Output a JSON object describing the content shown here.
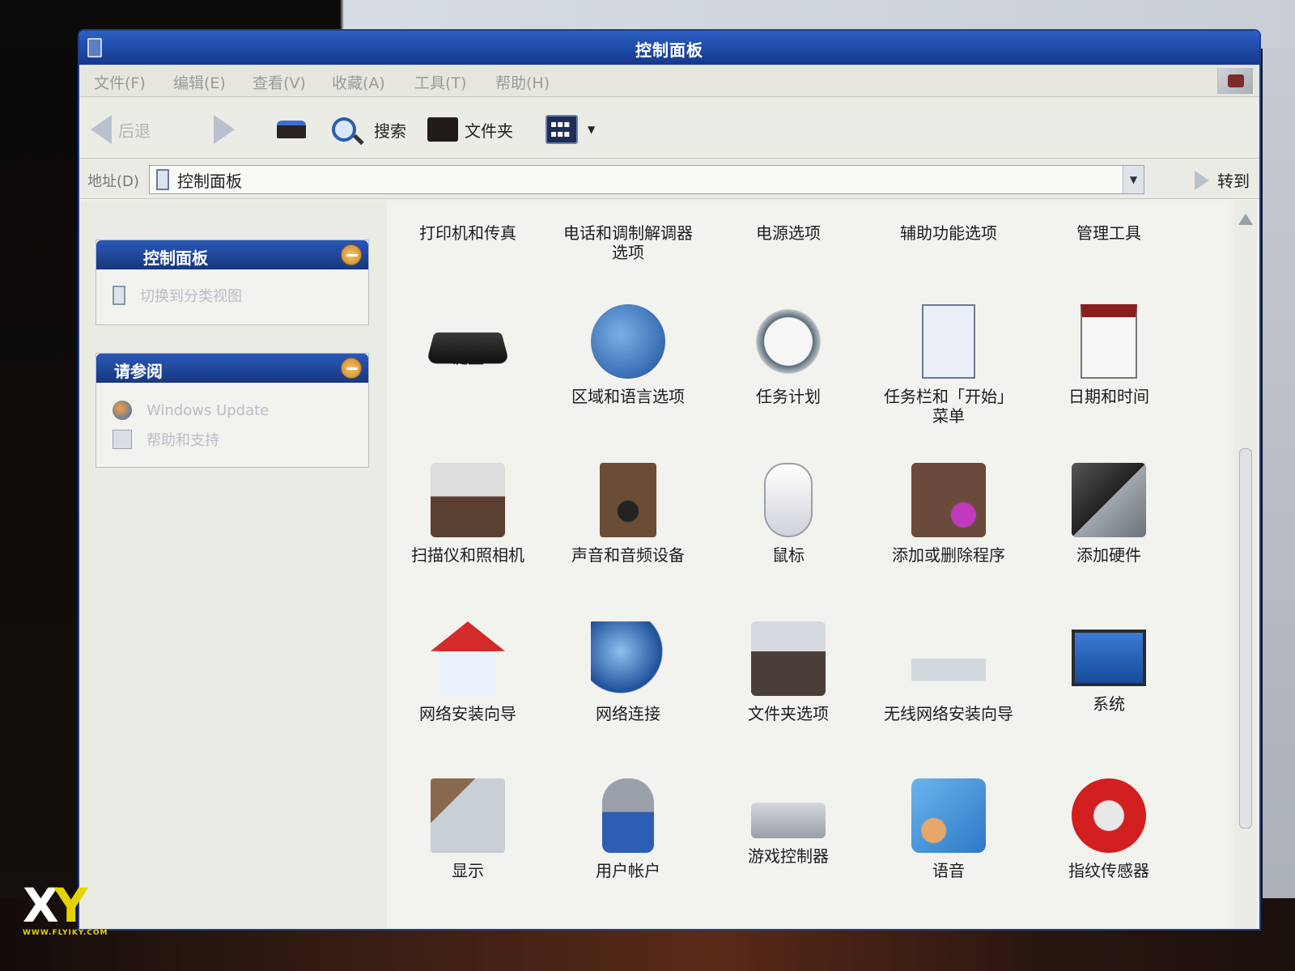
{
  "window": {
    "title": "控制面板"
  },
  "menu": [
    {
      "label": "文件(F)"
    },
    {
      "label": "编辑(E)"
    },
    {
      "label": "查看(V)"
    },
    {
      "label": "收藏(A)"
    },
    {
      "label": "工具(T)"
    },
    {
      "label": "帮助(H)"
    }
  ],
  "toolbar": {
    "back_label": "后退",
    "search_label": "搜索",
    "folders_label": "文件夹"
  },
  "address": {
    "label": "地址(D)",
    "value": "控制面板",
    "go_label": "转到"
  },
  "sidebar": {
    "panel1": {
      "title": "控制面板",
      "links": [
        {
          "label": "切换到分类视图"
        }
      ]
    },
    "panel2": {
      "title": "请参阅",
      "links": [
        {
          "label": "Windows Update"
        },
        {
          "label": "帮助和支持"
        }
      ]
    }
  },
  "items": [
    {
      "label": "打印机和传真",
      "icon": "printer-icon"
    },
    {
      "label": "电话和调制解调器\n选项",
      "icon": "phone-modem-icon"
    },
    {
      "label": "电源选项",
      "icon": "power-icon"
    },
    {
      "label": "辅助功能选项",
      "icon": "accessibility-icon"
    },
    {
      "label": "管理工具",
      "icon": "admin-tools-icon"
    },
    {
      "label": "键盘",
      "icon": "keyboard-icon"
    },
    {
      "label": "区域和语言选项",
      "icon": "region-language-icon"
    },
    {
      "label": "任务计划",
      "icon": "scheduled-tasks-icon"
    },
    {
      "label": "任务栏和「开始」\n菜单",
      "icon": "taskbar-start-menu-icon"
    },
    {
      "label": "日期和时间",
      "icon": "date-time-icon"
    },
    {
      "label": "扫描仪和照相机",
      "icon": "scanner-camera-icon"
    },
    {
      "label": "声音和音频设备",
      "icon": "sound-audio-icon"
    },
    {
      "label": "鼠标",
      "icon": "mouse-icon"
    },
    {
      "label": "添加或删除程序",
      "icon": "add-remove-programs-icon"
    },
    {
      "label": "添加硬件",
      "icon": "add-hardware-icon"
    },
    {
      "label": "网络安装向导",
      "icon": "network-setup-icon"
    },
    {
      "label": "网络连接",
      "icon": "network-connections-icon"
    },
    {
      "label": "文件夹选项",
      "icon": "folder-options-icon"
    },
    {
      "label": "无线网络安装向导",
      "icon": "wireless-network-icon"
    },
    {
      "label": "系统",
      "icon": "system-icon"
    },
    {
      "label": "显示",
      "icon": "display-icon"
    },
    {
      "label": "用户帐户",
      "icon": "user-accounts-icon"
    },
    {
      "label": "游戏控制器",
      "icon": "game-controllers-icon"
    },
    {
      "label": "语音",
      "icon": "speech-icon"
    },
    {
      "label": "指纹传感器",
      "icon": "fingerprint-sensor-icon"
    }
  ],
  "watermark": {
    "logo": "XY",
    "url": "WWW.FLYIKY.COM"
  },
  "colors": {
    "title_bar": "#1f4aa8",
    "panel_header": "#1f4aa8",
    "content_bg": "#f2f2ee"
  }
}
